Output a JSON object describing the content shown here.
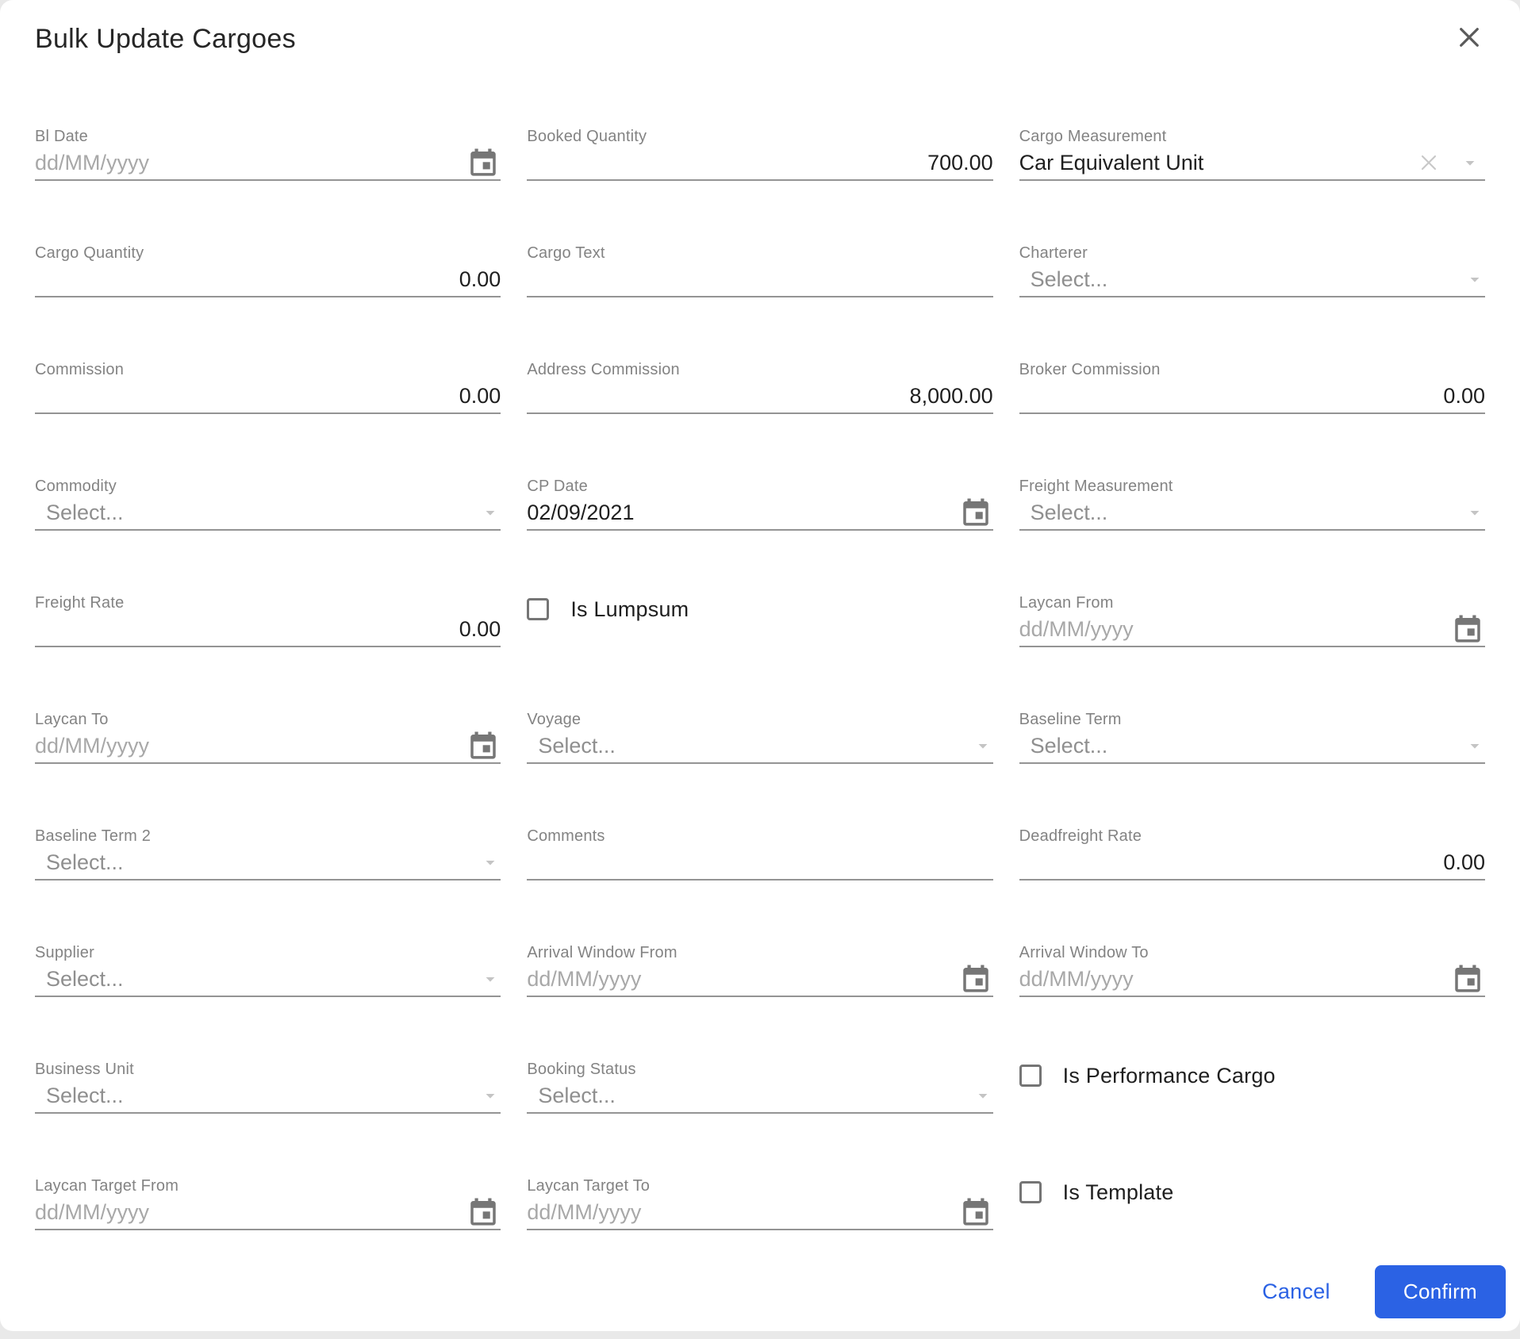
{
  "dialog": {
    "title": "Bulk Update Cargoes"
  },
  "colors": {
    "accent_blue": "#2B62E4",
    "confirm_text": "#FFFFFF",
    "label_gray": "#838383",
    "value_dark": "#1F1F1F",
    "placeholder_gray": "#A8A8A8",
    "underline_gray": "#949494",
    "icon_gray": "#767676"
  },
  "fields": {
    "bl_date": {
      "label": "Bl Date",
      "placeholder": "dd/MM/yyyy",
      "icon": "calendar-icon"
    },
    "booked_quantity": {
      "label": "Booked Quantity",
      "value": "700.00"
    },
    "cargo_measurement": {
      "label": "Cargo Measurement",
      "value": "Car Equivalent Unit",
      "icons": [
        "clear-icon",
        "chevron-down-icon"
      ]
    },
    "cargo_quantity": {
      "label": "Cargo Quantity",
      "value": "0.00"
    },
    "cargo_text": {
      "label": "Cargo Text",
      "value": ""
    },
    "charterer": {
      "label": "Charterer",
      "placeholder": "Select...",
      "icon": "chevron-down-icon"
    },
    "commission": {
      "label": "Commission",
      "value": "0.00"
    },
    "address_commission": {
      "label": "Address Commission",
      "value": "8,000.00"
    },
    "broker_commission": {
      "label": "Broker Commission",
      "value": "0.00"
    },
    "commodity": {
      "label": "Commodity",
      "placeholder": "Select...",
      "icon": "chevron-down-icon"
    },
    "cp_date": {
      "label": "CP Date",
      "value": "02/09/2021",
      "icon": "calendar-icon"
    },
    "freight_measurement": {
      "label": "Freight Measurement",
      "placeholder": "Select...",
      "icon": "chevron-down-icon"
    },
    "freight_rate": {
      "label": "Freight Rate",
      "value": "0.00"
    },
    "is_lumpsum": {
      "label": "Is Lumpsum",
      "checked": false
    },
    "laycan_from": {
      "label": "Laycan From",
      "placeholder": "dd/MM/yyyy",
      "icon": "calendar-icon"
    },
    "laycan_to": {
      "label": "Laycan To",
      "placeholder": "dd/MM/yyyy",
      "icon": "calendar-icon"
    },
    "voyage": {
      "label": "Voyage",
      "placeholder": "Select...",
      "icon": "chevron-down-icon"
    },
    "baseline_term": {
      "label": "Baseline Term",
      "placeholder": "Select...",
      "icon": "chevron-down-icon"
    },
    "baseline_term_2": {
      "label": "Baseline Term 2",
      "placeholder": "Select...",
      "icon": "chevron-down-icon"
    },
    "comments": {
      "label": "Comments",
      "value": ""
    },
    "deadfreight_rate": {
      "label": "Deadfreight Rate",
      "value": "0.00"
    },
    "supplier": {
      "label": "Supplier",
      "placeholder": "Select...",
      "icon": "chevron-down-icon"
    },
    "arrival_window_from": {
      "label": "Arrival Window From",
      "placeholder": "dd/MM/yyyy",
      "icon": "calendar-icon"
    },
    "arrival_window_to": {
      "label": "Arrival Window To",
      "placeholder": "dd/MM/yyyy",
      "icon": "calendar-icon"
    },
    "business_unit": {
      "label": "Business Unit",
      "placeholder": "Select...",
      "icon": "chevron-down-icon"
    },
    "booking_status": {
      "label": "Booking Status",
      "placeholder": "Select...",
      "icon": "chevron-down-icon"
    },
    "is_performance_cargo": {
      "label": "Is Performance Cargo",
      "checked": false
    },
    "laycan_target_from": {
      "label": "Laycan Target From",
      "placeholder": "dd/MM/yyyy",
      "icon": "calendar-icon"
    },
    "laycan_target_to": {
      "label": "Laycan Target To",
      "placeholder": "dd/MM/yyyy",
      "icon": "calendar-icon"
    },
    "is_template": {
      "label": "Is Template",
      "checked": false
    }
  },
  "footer": {
    "cancel_label": "Cancel",
    "confirm_label": "Confirm"
  }
}
